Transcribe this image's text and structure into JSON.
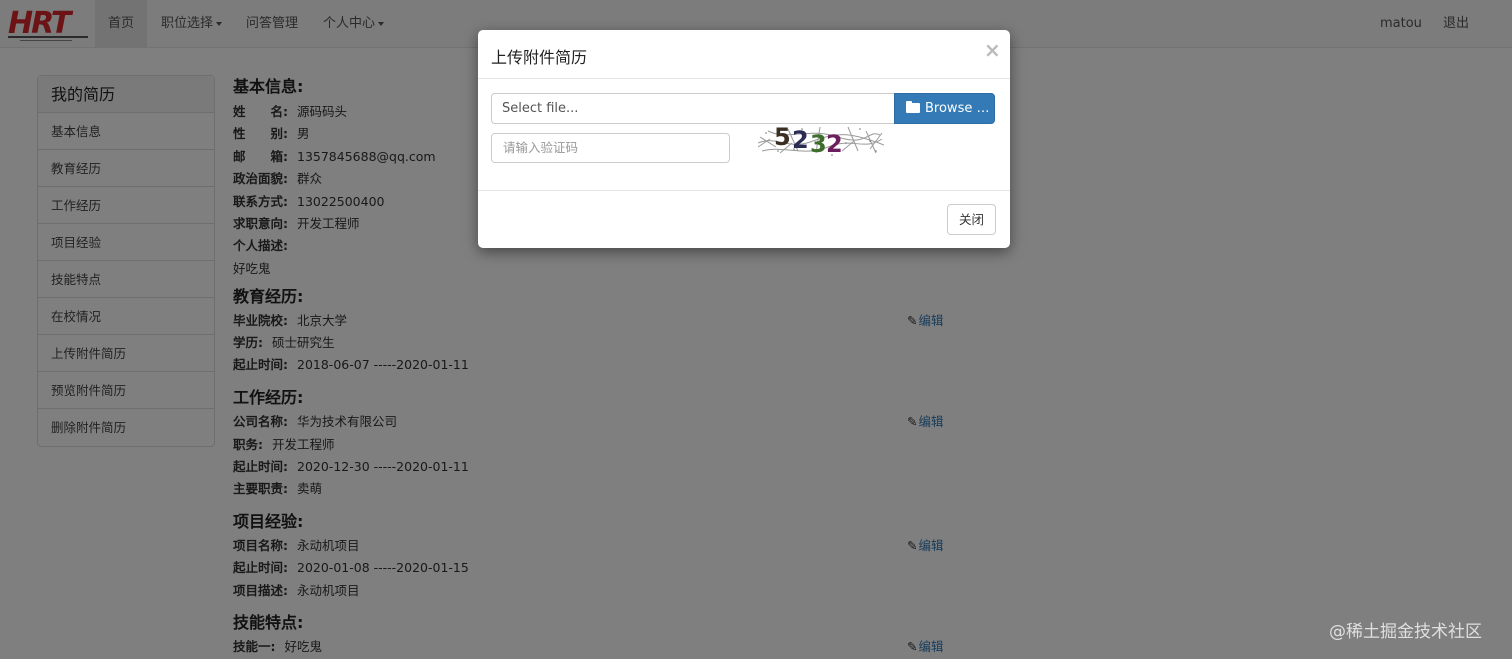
{
  "navbar": {
    "logo_text": "HRT",
    "items": [
      {
        "label": "首页",
        "dropdown": false,
        "active": true
      },
      {
        "label": "职位选择",
        "dropdown": true,
        "active": false
      },
      {
        "label": "问答管理",
        "dropdown": false,
        "active": false
      },
      {
        "label": "个人中心",
        "dropdown": true,
        "active": false
      }
    ],
    "username": "matou",
    "logout": "退出"
  },
  "sidebar": {
    "title": "我的简历",
    "items": [
      {
        "label": "基本信息"
      },
      {
        "label": "教育经历"
      },
      {
        "label": "工作经历"
      },
      {
        "label": "项目经验"
      },
      {
        "label": "技能特点"
      },
      {
        "label": "在校情况"
      },
      {
        "label": "上传附件简历"
      },
      {
        "label": "预览附件简历"
      },
      {
        "label": "删除附件简历"
      }
    ]
  },
  "resume": {
    "basic": {
      "title": "基本信息:",
      "rows": [
        {
          "key": "姓　　名:",
          "value": "源码码头"
        },
        {
          "key": "性　　别:",
          "value": "男"
        },
        {
          "key": "邮　　箱:",
          "value": "1357845688@qq.com"
        },
        {
          "key": "政治面貌:",
          "value": "群众"
        },
        {
          "key": "联系方式:",
          "value": "13022500400"
        },
        {
          "key": "求职意向:",
          "value": "开发工程师"
        },
        {
          "key": "个人描述:",
          "value": ""
        }
      ],
      "description": "好吃鬼"
    },
    "education": {
      "title": "教育经历:",
      "edit": "编辑",
      "rows": [
        {
          "key": "毕业院校:",
          "value": "北京大学"
        },
        {
          "key": "学历:",
          "value": "硕士研究生"
        },
        {
          "key": "起止时间:",
          "value": "2018-06-07 -----2020-01-11"
        }
      ]
    },
    "work": {
      "title": "工作经历:",
      "edit": "编辑",
      "rows": [
        {
          "key": "公司名称:",
          "value": "华为技术有限公司"
        },
        {
          "key": "职务:",
          "value": "开发工程师"
        },
        {
          "key": "起止时间:",
          "value": "2020-12-30 -----2020-01-11"
        },
        {
          "key": "主要职责:",
          "value": "卖萌"
        }
      ]
    },
    "project": {
      "title": "项目经验:",
      "edit": "编辑",
      "rows": [
        {
          "key": "项目名称:",
          "value": "永动机项目"
        },
        {
          "key": "起止时间:",
          "value": "2020-01-08 -----2020-01-15"
        },
        {
          "key": "项目描述:",
          "value": "永动机项目"
        }
      ]
    },
    "skills": {
      "title": "技能特点:",
      "edit": "编辑",
      "rows": [
        {
          "key": "技能一:",
          "value": "好吃鬼"
        }
      ]
    }
  },
  "modal": {
    "title": "上传附件简历",
    "close_symbol": "×",
    "file_placeholder": "Select file...",
    "browse_label": "Browse …",
    "captcha_placeholder": "请输入验证码",
    "captcha_text": "5232",
    "close_button": "关闭"
  },
  "watermark": "@稀土掘金技术社区",
  "colors": {
    "primary": "#337ab7",
    "navbar_bg": "#f8f8f8",
    "logo_red": "#d9262c"
  }
}
